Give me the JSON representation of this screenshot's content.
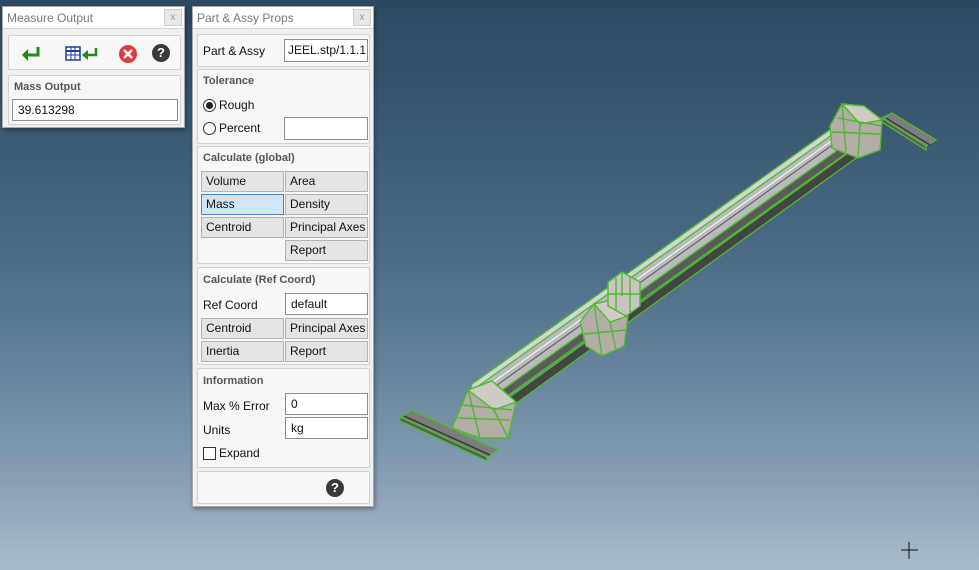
{
  "measure_output": {
    "title": "Measure Output",
    "close_glyph": "x",
    "toolbar": {
      "apply_icon": "green-return-arrow-icon",
      "apply_table_icon": "table-return-icon",
      "cancel_icon": "red-cancel-icon",
      "help_icon": "help-icon",
      "help_glyph": "?"
    },
    "mass_output": {
      "label": "Mass Output",
      "value": "39.613298"
    }
  },
  "part_assy_props": {
    "title": "Part & Assy Props",
    "close_glyph": "x",
    "part_assy": {
      "label": "Part & Assy",
      "value": "JEEL.stp/1.1.1"
    },
    "tolerance": {
      "title": "Tolerance",
      "options": [
        {
          "label": "Rough",
          "checked": true
        },
        {
          "label": "Percent",
          "checked": false
        }
      ],
      "percent_value": ""
    },
    "calculate_global": {
      "title": "Calculate (global)",
      "buttons": [
        "Volume",
        "Area",
        "Mass",
        "Density",
        "Centroid",
        "Principal Axes",
        "Report"
      ],
      "active": "Mass"
    },
    "calculate_ref": {
      "title": "Calculate (Ref Coord)",
      "ref_coord_label": "Ref Coord",
      "ref_coord_value": "default",
      "buttons": [
        "Centroid",
        "Principal Axes",
        "Inertia",
        "Report"
      ]
    },
    "information": {
      "title": "Information",
      "max_error_label": "Max % Error",
      "max_error_value": "0",
      "units_label": "Units",
      "units_value": "kg",
      "expand_label": "Expand",
      "expand_checked": false
    },
    "footer": {
      "help_icon": "help-icon",
      "help_glyph": "?"
    }
  },
  "viewport": {
    "model_highlight_color": "#47b82c",
    "background_top": "#2d4860",
    "background_bottom": "#a9bccb"
  }
}
